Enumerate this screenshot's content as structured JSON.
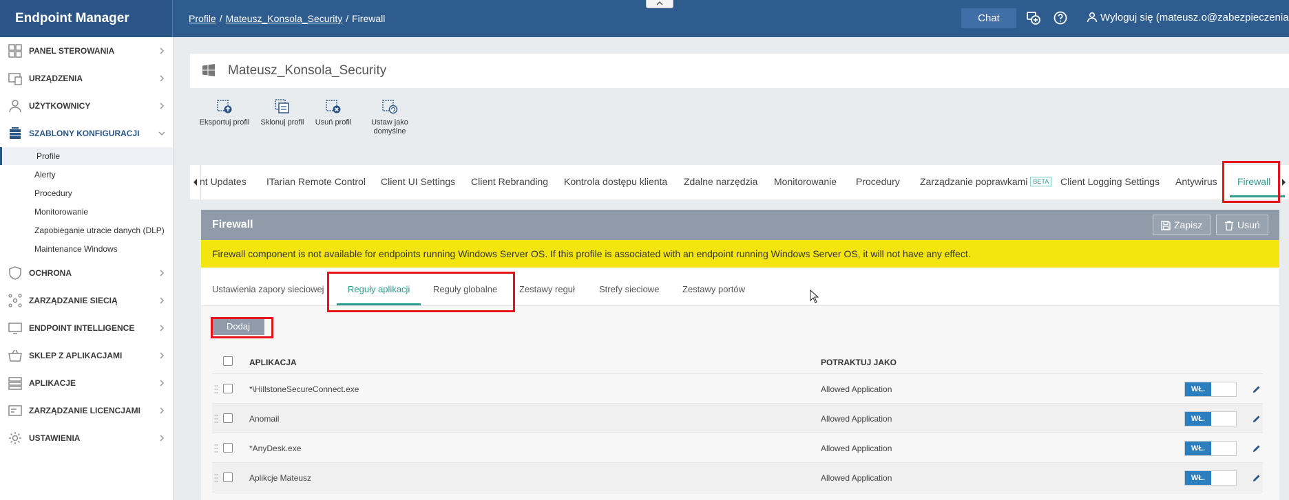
{
  "app": {
    "title": "Endpoint Manager"
  },
  "breadcrumb": {
    "root": "Profile",
    "parent": "Mateusz_Konsola_Security",
    "current": "Firewall",
    "separator": "/"
  },
  "header": {
    "chat_label": "Chat",
    "user_label": "Wyloguj się (mateusz.o@zabezpieczenia.it)"
  },
  "sidebar": {
    "items": [
      {
        "label": "PANEL STEROWANIA"
      },
      {
        "label": "URZĄDZENIA"
      },
      {
        "label": "UŻYTKOWNICY"
      },
      {
        "label": "SZABLONY KONFIGURACJI"
      },
      {
        "label": "OCHRONA"
      },
      {
        "label": "ZARZĄDZANIE SIECIĄ"
      },
      {
        "label": "ENDPOINT INTELLIGENCE"
      },
      {
        "label": "SKLEP Z APLIKACJAMI"
      },
      {
        "label": "APLIKACJE"
      },
      {
        "label": "ZARZĄDZANIE LICENCJAMI"
      },
      {
        "label": "USTAWIENIA"
      }
    ],
    "subitems": [
      {
        "label": "Profile"
      },
      {
        "label": "Alerty"
      },
      {
        "label": "Procedury"
      },
      {
        "label": "Monitorowanie"
      },
      {
        "label": "Zapobieganie utracie danych (DLP)"
      },
      {
        "label": "Maintenance Windows"
      }
    ]
  },
  "profile": {
    "name": "Mateusz_Konsola_Security"
  },
  "toolbar": {
    "export": "Eksportuj profil",
    "clone": "Sklonuj profil",
    "delete": "Usuń profil",
    "default_line1": "Ustaw jako",
    "default_line2": "domyślne"
  },
  "module_tabs": {
    "items": [
      "nt Updates",
      "ITarian Remote Control",
      "Client UI Settings",
      "Client Rebranding",
      "Kontrola dostępu klienta",
      "Zdalne narzędzia",
      "Monitorowanie",
      "Procedury",
      "Zarządzanie poprawkami",
      "Client Logging Settings",
      "Antywirus",
      "Firewall"
    ],
    "beta_badge": "BETA",
    "active": "Firewall"
  },
  "firewall": {
    "title": "Firewall",
    "save_label": "Zapisz",
    "delete_label": "Usuń",
    "warning": "Firewall component is not available for endpoints running Windows Server OS. If this profile is associated with an endpoint running Windows Server OS, it will not have any effect.",
    "subtabs": [
      "Ustawienia zapory sieciowej",
      "Reguły aplikacji",
      "Reguły globalne",
      "Zestawy reguł",
      "Strefy sieciowe",
      "Zestawy portów"
    ],
    "active_subtab": "Reguły aplikacji",
    "add_label": "Dodaj",
    "table": {
      "headers": {
        "app": "APLIKACJA",
        "treat_as": "POTRAKTUJ JAKO"
      },
      "rows": [
        {
          "app": "*\\HillstoneSecureConnect.exe",
          "treat_as": "Allowed Application",
          "state": "WŁ."
        },
        {
          "app": "Anomail",
          "treat_as": "Allowed Application",
          "state": "WŁ."
        },
        {
          "app": "*AnyDesk.exe",
          "treat_as": "Allowed Application",
          "state": "WŁ."
        },
        {
          "app": "Aplikcje Mateusz",
          "treat_as": "Allowed Application",
          "state": "WŁ."
        }
      ]
    }
  },
  "colors": {
    "topbar": "#2f5c8f",
    "accent": "#2a9d8f",
    "warning": "#f5e50e",
    "highlight": "#e8121b",
    "toggle_on": "#2a7fc1"
  }
}
